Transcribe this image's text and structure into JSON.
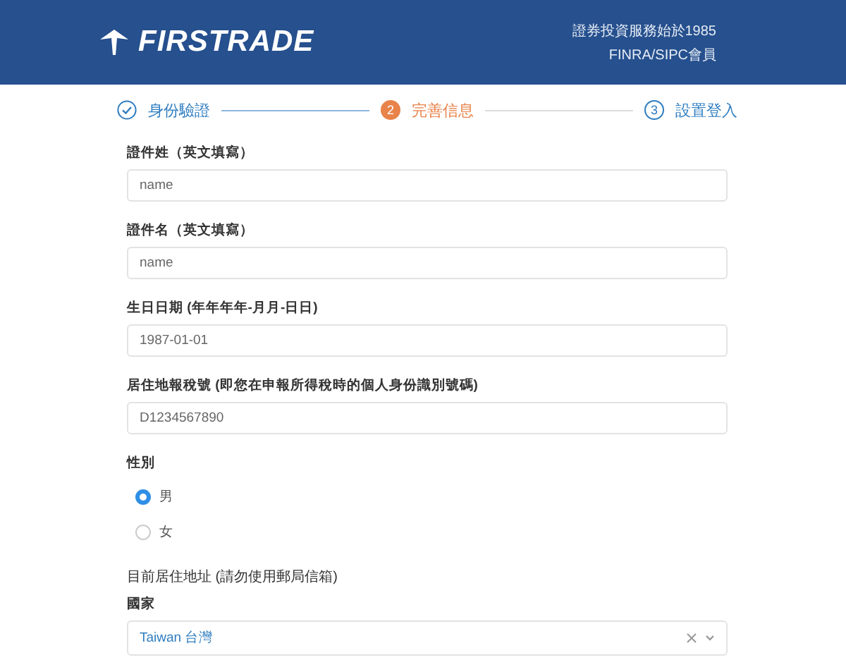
{
  "header": {
    "logo": "FIRSTRADE",
    "tagline": [
      "證券投資服務始於1985",
      "FINRA/SIPC會員"
    ]
  },
  "steps": [
    {
      "label": "身份驗證",
      "done": true,
      "selected": false
    },
    {
      "number": "2",
      "label": "完善信息",
      "done": false,
      "selected": true
    },
    {
      "number": "3",
      "label": "設置登入",
      "done": false,
      "selected": false
    }
  ],
  "fields": [
    {
      "label": "證件姓（英文填寫）",
      "value": "name"
    },
    {
      "label": "證件名（英文填寫）",
      "value": "name"
    },
    {
      "label": "生日日期 (年年年年-月月-日日)",
      "value": "1987-01-01"
    },
    {
      "label": "居住地報稅號 (即您在申報所得稅時的個人身份識別號碼)",
      "value": "D1234567890"
    }
  ],
  "gender": {
    "label": "性別",
    "options": [
      {
        "label": "男",
        "selected": true
      },
      {
        "label": "女",
        "selected": false
      }
    ]
  },
  "address": {
    "heading": "目前居住地址 (請勿使用郵局信箱)",
    "country_label": "國家",
    "country_value": "Taiwan 台灣"
  }
}
